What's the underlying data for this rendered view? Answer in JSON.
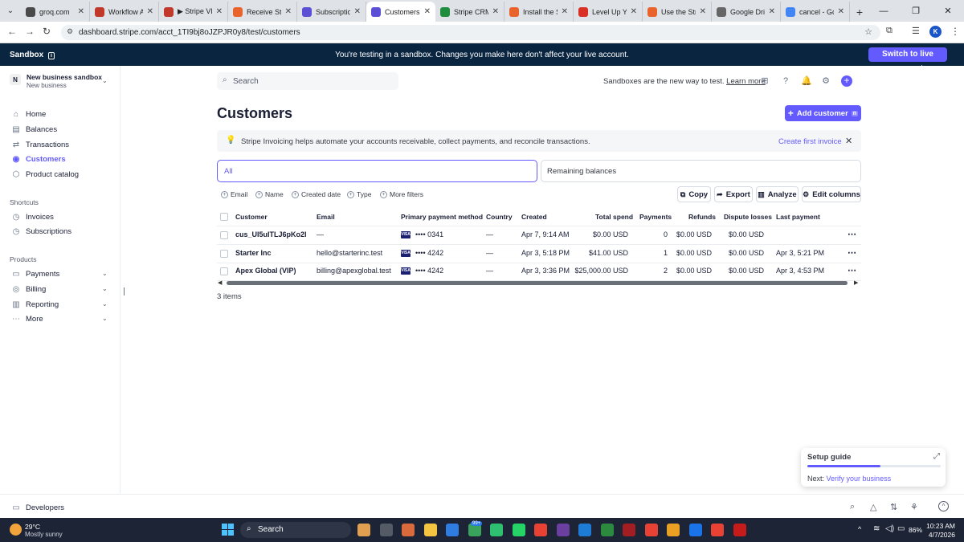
{
  "browser": {
    "tabs": [
      {
        "title": "groq.com",
        "color": "#4a4a4a"
      },
      {
        "title": "Workflow Au",
        "color": "#c0392b"
      },
      {
        "title": "▶ Stripe VIP",
        "color": "#c0392b"
      },
      {
        "title": "Receive Strip",
        "color": "#e8642c"
      },
      {
        "title": "Subscription",
        "color": "#5b4fd6"
      },
      {
        "title": "Customers",
        "color": "#5b4fd6"
      },
      {
        "title": "Stripe CRM",
        "color": "#1e8e3e"
      },
      {
        "title": "Install the St",
        "color": "#e8642c"
      },
      {
        "title": "Level Up You",
        "color": "#d93025"
      },
      {
        "title": "Use the Strip",
        "color": "#e8642c"
      },
      {
        "title": "Google Drive",
        "color": "#666666"
      },
      {
        "title": "cancel - Goo",
        "color": "#4285f4"
      }
    ],
    "active_tab": 5,
    "url": "dashboard.stripe.com/acct_1TI9bj8oJZPJR0y8/test/customers",
    "profile_initial": "K"
  },
  "banner": {
    "label": "Sandbox",
    "message": "You're testing in a sandbox. Changes you make here don't affect your live account.",
    "switch_button": "Switch to live account"
  },
  "account": {
    "initial": "N",
    "name": "New business sandbox",
    "sub": "New business"
  },
  "sidebar": {
    "main_items": [
      {
        "label": "Home",
        "icon": "home-icon"
      },
      {
        "label": "Balances",
        "icon": "balances-icon"
      },
      {
        "label": "Transactions",
        "icon": "transactions-icon"
      },
      {
        "label": "Customers",
        "icon": "customers-icon"
      },
      {
        "label": "Product catalog",
        "icon": "product-catalog-icon"
      }
    ],
    "shortcuts_title": "Shortcuts",
    "shortcuts": [
      {
        "label": "Invoices"
      },
      {
        "label": "Subscriptions"
      }
    ],
    "products_title": "Products",
    "products": [
      {
        "label": "Payments"
      },
      {
        "label": "Billing"
      },
      {
        "label": "Reporting"
      },
      {
        "label": "More"
      }
    ],
    "developers": "Developers"
  },
  "header": {
    "search_placeholder": "Search",
    "notice": "Sandboxes are the new way to test.",
    "learn_more": "Learn more"
  },
  "page": {
    "title": "Customers",
    "add_button": "Add customer",
    "add_shortcut": "n",
    "info_text": "Stripe Invoicing helps automate your accounts receivable, collect payments, and reconcile transactions.",
    "info_link": "Create first invoice",
    "views": [
      "All",
      "Remaining balances"
    ],
    "filters": [
      "Email",
      "Name",
      "Created date",
      "Type",
      "More filters"
    ],
    "actions": [
      "Copy",
      "Export",
      "Analyze",
      "Edit columns"
    ],
    "columns": [
      "Customer",
      "Email",
      "Primary payment method",
      "Country",
      "Created",
      "Total spend",
      "Payments",
      "Refunds",
      "Dispute losses",
      "Last payment"
    ],
    "rows": [
      {
        "customer": "cus_UI5uITLJ6pKo2I",
        "email": "—",
        "card": "•••• 0341",
        "country": "—",
        "created": "Apr 7, 9:14 AM",
        "total": "$0.00 USD",
        "payments": "0",
        "refunds": "$0.00 USD",
        "disputes": "$0.00 USD",
        "last": ""
      },
      {
        "customer": "Starter Inc",
        "email": "hello@starterinc.test",
        "card": "•••• 4242",
        "country": "—",
        "created": "Apr 3, 5:18 PM",
        "total": "$41.00 USD",
        "payments": "1",
        "refunds": "$0.00 USD",
        "disputes": "$0.00 USD",
        "last": "Apr 3, 5:21 PM"
      },
      {
        "customer": "Apex Global (VIP)",
        "email": "billing@apexglobal.test",
        "card": "•••• 4242",
        "country": "—",
        "created": "Apr 3, 3:36 PM",
        "total": "$25,000.00 USD",
        "payments": "2",
        "refunds": "$0.00 USD",
        "disputes": "$0.00 USD",
        "last": "Apr 3, 4:53 PM"
      }
    ],
    "count": "3 items"
  },
  "setup_guide": {
    "title": "Setup guide",
    "progress": 0.55,
    "next_label": "Next:",
    "next_link": "Verify your business"
  },
  "taskbar": {
    "weather_temp": "29°C",
    "weather_desc": "Mostly sunny",
    "search": "Search",
    "battery": "86%",
    "time": "10:23 AM",
    "date": "4/7/2026",
    "badge": "99+"
  },
  "colors": {
    "accent": "#635bff",
    "banner": "#0a2540",
    "taskbar": "#1c2436"
  }
}
